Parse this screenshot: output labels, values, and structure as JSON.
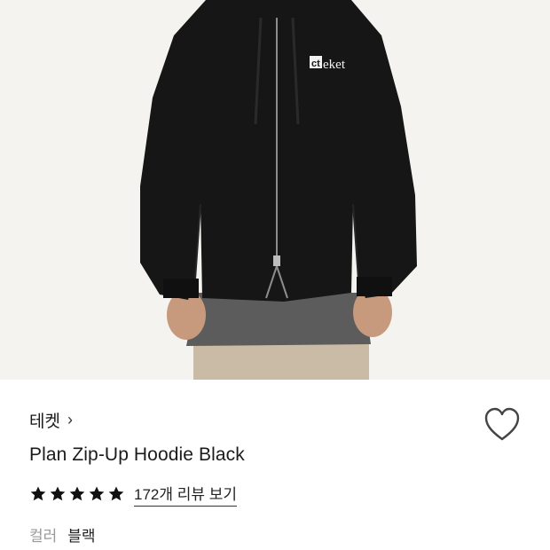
{
  "product": {
    "brand": "테켓",
    "brand_chevron": "›",
    "name": "Plan Zip-Up Hoodie Black",
    "logo_text": "eket",
    "rating": 5,
    "reviews_text": "172개 리뷰 보기",
    "option_label": "컬러",
    "option_value": "블랙"
  },
  "icons": {
    "heart": "heart-outline-icon",
    "star": "star-filled-icon",
    "chevron": "chevron-right-icon"
  },
  "colors": {
    "hoodie": "#161616",
    "background": "#f4f3ef",
    "pants": "#c9bba6",
    "inner_shirt": "#5c5c5c",
    "star": "#111111"
  }
}
